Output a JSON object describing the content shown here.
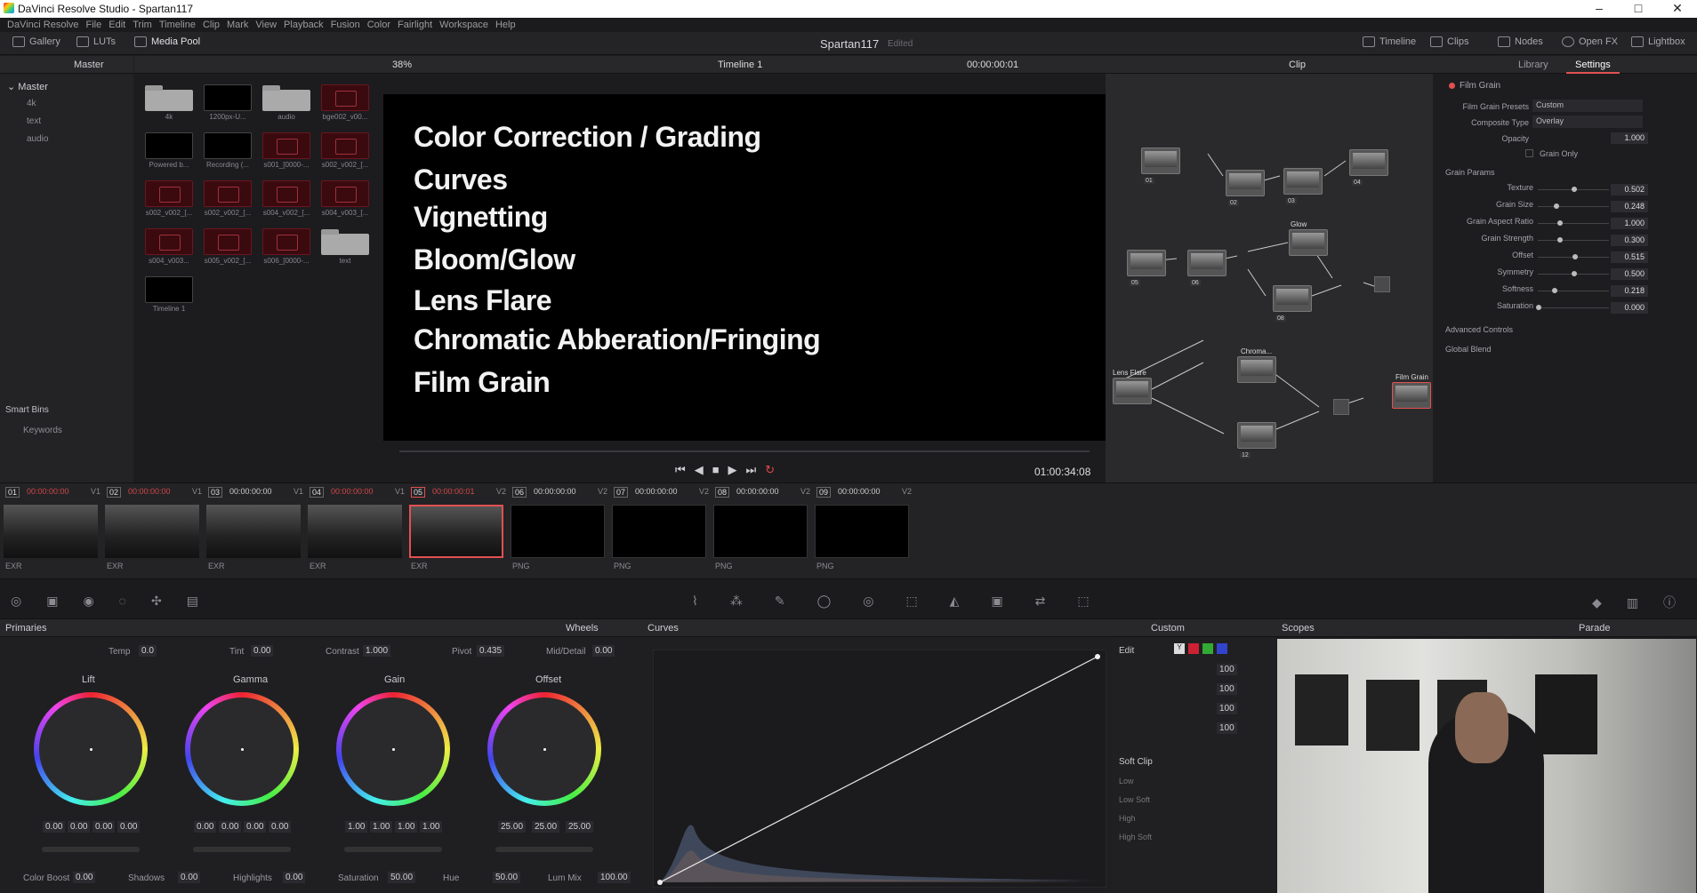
{
  "window": {
    "title": "DaVinci Resolve Studio - Spartan117"
  },
  "menu": [
    "DaVinci Resolve",
    "File",
    "Edit",
    "Trim",
    "Timeline",
    "Clip",
    "Mark",
    "View",
    "Playback",
    "Fusion",
    "Color",
    "Fairlight",
    "Workspace",
    "Help"
  ],
  "toolbar": {
    "gallery": "Gallery",
    "luts": "LUTs",
    "media_pool": "Media Pool",
    "project": "Spartan117",
    "edited": "Edited",
    "timeline": "Timeline",
    "clips": "Clips",
    "nodes": "Nodes",
    "openfx": "Open FX",
    "lightbox": "Lightbox"
  },
  "bins": {
    "header": "Master",
    "root": "Master",
    "items": [
      "4k",
      "text",
      "audio"
    ],
    "smart": "Smart Bins",
    "keywords": "Keywords"
  },
  "media": [
    {
      "name": "4k",
      "kind": "folder"
    },
    {
      "name": "1200px-U...",
      "kind": "dark"
    },
    {
      "name": "audio",
      "kind": "folder"
    },
    {
      "name": "bge002_v00...",
      "kind": "red"
    },
    {
      "name": "Powered b...",
      "kind": "dark"
    },
    {
      "name": "Recording (...",
      "kind": "dark"
    },
    {
      "name": "s001_[0000-...",
      "kind": "red"
    },
    {
      "name": "s002_v002_[...",
      "kind": "red"
    },
    {
      "name": "s002_v002_[...",
      "kind": "red"
    },
    {
      "name": "s002_v002_[...",
      "kind": "red"
    },
    {
      "name": "s004_v002_[...",
      "kind": "red"
    },
    {
      "name": "s004_v003_[...",
      "kind": "red"
    },
    {
      "name": "s004_v003...",
      "kind": "red"
    },
    {
      "name": "s005_v002_[...",
      "kind": "red"
    },
    {
      "name": "s006_[0000-...",
      "kind": "red"
    },
    {
      "name": "text",
      "kind": "folder"
    },
    {
      "name": "Timeline 1",
      "kind": "dark"
    }
  ],
  "viewer": {
    "zoom": "38%",
    "timeline": "Timeline 1",
    "timecode": "00:00:00:01",
    "duration": "01:00:34:08",
    "lines": [
      "Color Correction / Grading",
      "Curves",
      "Vignetting",
      "Bloom/Glow",
      "Lens Flare",
      "Chromatic Abberation/Fringing",
      "Film Grain"
    ]
  },
  "nodes": {
    "mode": "Clip",
    "labels": {
      "glow": "Glow",
      "lensflare": "Lens Flare",
      "chroma": "Chroma...",
      "filmgrain": "Film Grain"
    },
    "ids": [
      "01",
      "02",
      "03",
      "04",
      "05",
      "06",
      "08",
      "12"
    ]
  },
  "settings": {
    "tabs": [
      "Library",
      "Settings"
    ],
    "title": "Film Grain",
    "presets_label": "Film Grain Presets",
    "presets_value": "Custom",
    "composite_label": "Composite Type",
    "composite_value": "Overlay",
    "opacity_label": "Opacity",
    "opacity": "1.000",
    "grain_only": "Grain Only",
    "grain_params": "Grain Params",
    "params": [
      {
        "k": "Texture",
        "v": "0.502",
        "pos": 0.5
      },
      {
        "k": "Grain Size",
        "v": "0.248",
        "pos": 0.25
      },
      {
        "k": "Grain Aspect Ratio",
        "v": "1.000",
        "pos": 0.3
      },
      {
        "k": "Grain Strength",
        "v": "0.300",
        "pos": 0.3
      },
      {
        "k": "Offset",
        "v": "0.515",
        "pos": 0.51
      },
      {
        "k": "Symmetry",
        "v": "0.500",
        "pos": 0.5
      },
      {
        "k": "Softness",
        "v": "0.218",
        "pos": 0.22
      },
      {
        "k": "Saturation",
        "v": "0.000",
        "pos": 0.0
      }
    ],
    "advanced": "Advanced Controls",
    "global": "Global Blend"
  },
  "strip": [
    {
      "n": "01",
      "tc": "00:00:00:00",
      "tr": "V1",
      "fmt": "EXR",
      "red": true
    },
    {
      "n": "02",
      "tc": "00:00:00:00",
      "tr": "V1",
      "fmt": "EXR",
      "red": true
    },
    {
      "n": "03",
      "tc": "00:00:00:00",
      "tr": "V1",
      "fmt": "EXR",
      "red": false
    },
    {
      "n": "04",
      "tc": "00:00:00:00",
      "tr": "V1",
      "fmt": "EXR",
      "red": true
    },
    {
      "n": "05",
      "tc": "00:00:00:01",
      "tr": "V2",
      "fmt": "EXR",
      "red": true
    },
    {
      "n": "06",
      "tc": "00:00:00:00",
      "tr": "V2",
      "fmt": "PNG",
      "red": false
    },
    {
      "n": "07",
      "tc": "00:00:00:00",
      "tr": "V2",
      "fmt": "PNG",
      "red": false
    },
    {
      "n": "08",
      "tc": "00:00:00:00",
      "tr": "V2",
      "fmt": "PNG",
      "red": false
    },
    {
      "n": "09",
      "tc": "00:00:00:00",
      "tr": "V2",
      "fmt": "PNG",
      "red": false
    }
  ],
  "primaries": {
    "title": "Primaries",
    "mode": "Wheels",
    "temp_l": "Temp",
    "temp": "0.0",
    "tint_l": "Tint",
    "tint": "0.00",
    "contrast_l": "Contrast",
    "contrast": "1.000",
    "pivot_l": "Pivot",
    "pivot": "0.435",
    "md_l": "Mid/Detail",
    "md": "0.00",
    "wheels": [
      {
        "name": "Lift",
        "vals": [
          "0.00",
          "0.00",
          "0.00",
          "0.00"
        ]
      },
      {
        "name": "Gamma",
        "vals": [
          "0.00",
          "0.00",
          "0.00",
          "0.00"
        ]
      },
      {
        "name": "Gain",
        "vals": [
          "1.00",
          "1.00",
          "1.00",
          "1.00"
        ]
      },
      {
        "name": "Offset",
        "vals": [
          "25.00",
          "25.00",
          "25.00"
        ]
      }
    ],
    "bottom": [
      {
        "k": "Color Boost",
        "v": "0.00"
      },
      {
        "k": "Shadows",
        "v": "0.00"
      },
      {
        "k": "Highlights",
        "v": "0.00"
      },
      {
        "k": "Saturation",
        "v": "50.00"
      },
      {
        "k": "Hue",
        "v": "50.00"
      },
      {
        "k": "Lum Mix",
        "v": "100.00"
      }
    ]
  },
  "curves": {
    "title": "Curves",
    "preset": "Custom"
  },
  "edit": {
    "title": "Edit",
    "vals": [
      "100",
      "100",
      "100",
      "100"
    ],
    "softclip": "Soft Clip",
    "low": "Low",
    "lowsoft": "Low Soft",
    "high": "High",
    "highsoft": "High Soft"
  },
  "scopes": {
    "title": "Scopes",
    "mode": "Parade"
  }
}
